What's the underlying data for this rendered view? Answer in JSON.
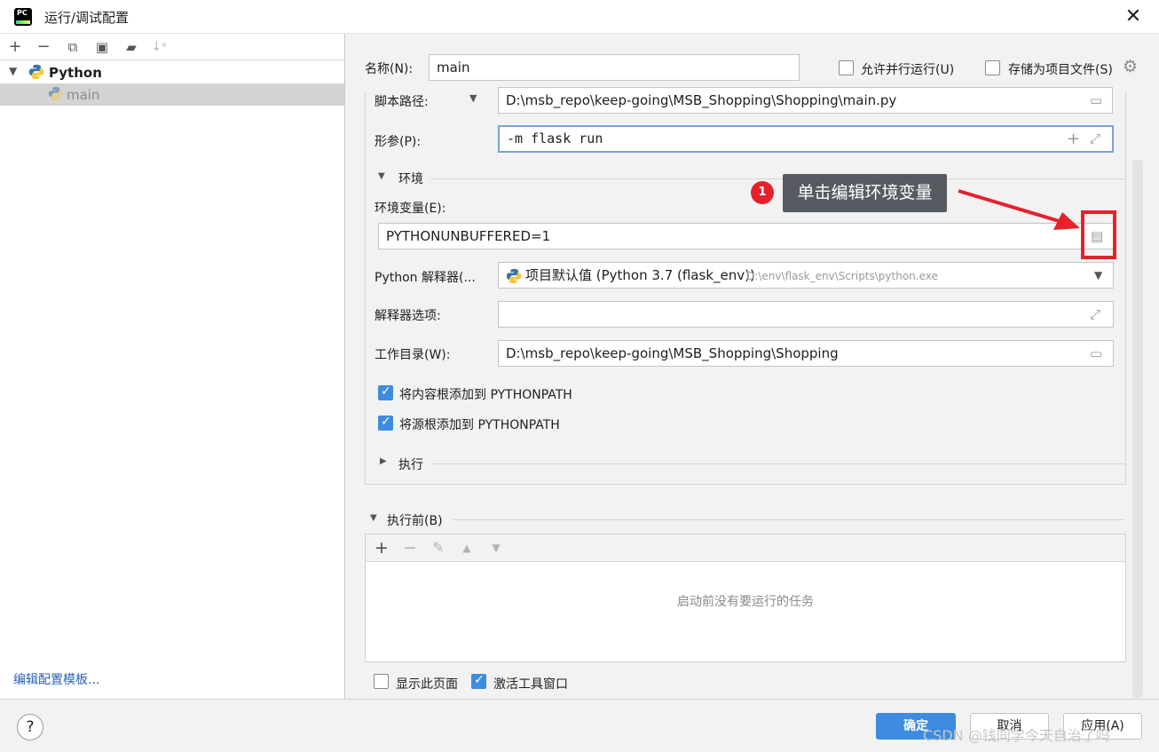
{
  "window": {
    "title": "运行/调试配置",
    "close": "✕"
  },
  "left": {
    "toolbar": [
      "+",
      "−",
      "⧉",
      "🖫",
      "▪",
      "↓a"
    ],
    "tree": {
      "group": "Python",
      "item": "main"
    },
    "edit_templates": "编辑配置模板..."
  },
  "right": {
    "name_label": "名称(N):",
    "name_value": "main",
    "allow_parallel": {
      "label": "允许并行运行(U)",
      "checked": false
    },
    "store_as_project": {
      "label": "存储为项目文件(S)",
      "checked": false
    },
    "script_label": "脚本路径:",
    "script_value": "D:\\msb_repo\\keep-going\\MSB_Shopping\\Shopping\\main.py",
    "params_label": "形参(P):",
    "params_value": "-m flask run",
    "env_section": "环境",
    "env_vars_label": "环境变量(E):",
    "env_vars_value": "PYTHONUNBUFFERED=1",
    "interpreter_label": "Python 解释器(...",
    "interpreter_value": "项目默认值 (Python 3.7 (flask_env))",
    "interpreter_path": "D:\\env\\flask_env\\Scripts\\python.exe",
    "interp_options_label": "解释器选项:",
    "interp_options_value": "",
    "workdir_label": "工作目录(W):",
    "workdir_value": "D:\\msb_repo\\keep-going\\MSB_Shopping\\Shopping",
    "add_content_roots": {
      "label": "将内容根添加到 PYTHONPATH",
      "checked": true
    },
    "add_source_roots": {
      "label": "将源根添加到 PYTHONPATH",
      "checked": true
    },
    "exec_section": "执行",
    "before_launch_label": "执行前(B)",
    "no_tasks": "启动前没有要运行的任务",
    "show_page": {
      "label": "显示此页面",
      "checked": false
    },
    "activate_tool": {
      "label": "激活工具窗口",
      "checked": true
    }
  },
  "annotation": {
    "number": "1",
    "text": "单击编辑环境变量",
    "color": "#e5222b"
  },
  "buttons": {
    "ok": "确定",
    "cancel": "取消",
    "apply": "应用(A)",
    "help": "?"
  },
  "watermark": "CSDN @钱同学今天自治了吗"
}
